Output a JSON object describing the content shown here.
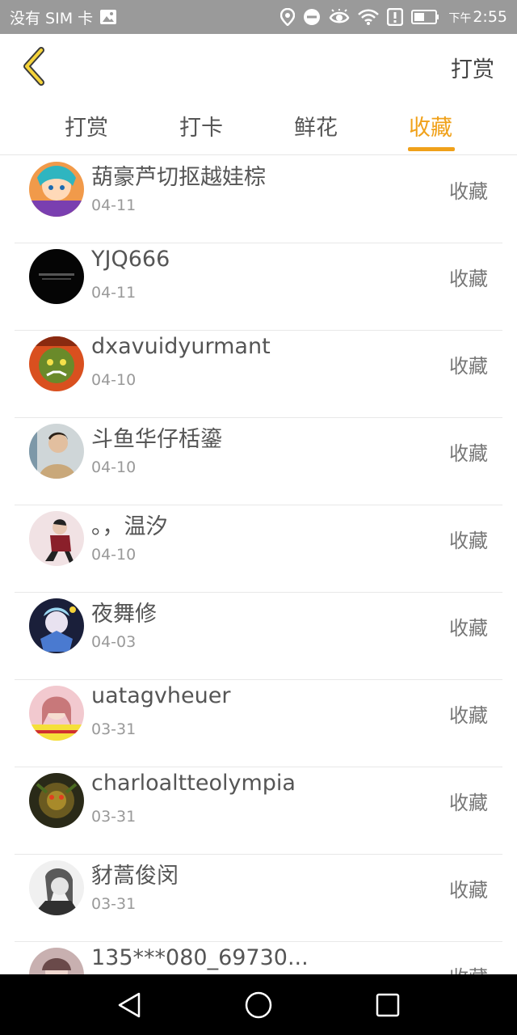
{
  "status_bar": {
    "carrier": "没有 SIM 卡",
    "time_prefix": "下午",
    "time": "2:55"
  },
  "header": {
    "action_label": "打赏"
  },
  "tabs": [
    {
      "label": "打赏",
      "active": false
    },
    {
      "label": "打卡",
      "active": false
    },
    {
      "label": "鲜花",
      "active": false
    },
    {
      "label": "收藏",
      "active": true
    }
  ],
  "colors": {
    "accent": "#f0a11a",
    "status_bar": "#9a9a9a",
    "nav_bar": "#000000"
  },
  "list": {
    "items": [
      {
        "name": "葫豪芦切抠越娃棕",
        "date": "04-11",
        "action": "收藏",
        "avatar": "anime-girl-avatar"
      },
      {
        "name": "YJQ666",
        "date": "04-11",
        "action": "收藏",
        "avatar": "black-logo-avatar"
      },
      {
        "name": "dxavuidyurmant",
        "date": "04-10",
        "action": "收藏",
        "avatar": "orc-warrior-avatar"
      },
      {
        "name": "斗鱼华仔栝鎏",
        "date": "04-10",
        "action": "收藏",
        "avatar": "young-man-avatar"
      },
      {
        "name": "。，温汐",
        "date": "04-10",
        "action": "收藏",
        "avatar": "man-in-red-jacket-avatar"
      },
      {
        "name": "夜舞修",
        "date": "04-03",
        "action": "收藏",
        "avatar": "anime-character-blue-avatar"
      },
      {
        "name": "uatagvheuer",
        "date": "03-31",
        "action": "收藏",
        "avatar": "girl-photo-avatar"
      },
      {
        "name": "charloaltteolympia",
        "date": "03-31",
        "action": "收藏",
        "avatar": "dark-creature-avatar"
      },
      {
        "name": "豺蒿俊闵",
        "date": "03-31",
        "action": "收藏",
        "avatar": "grayscale-face-avatar"
      },
      {
        "name": "135***080_69730...",
        "date": "",
        "action": "收藏",
        "avatar": "partial-avatar"
      }
    ]
  }
}
